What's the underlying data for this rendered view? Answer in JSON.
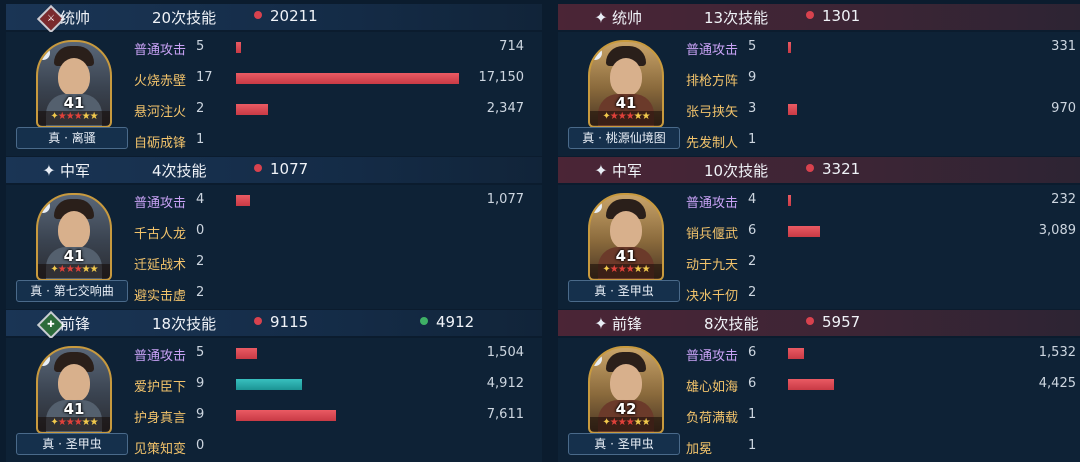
{
  "left": [
    {
      "role": "统帅",
      "skills": "20次技能",
      "damage": "20211",
      "heal": "",
      "emblem": "diamond-red",
      "level": "41",
      "name": "真 · 离骚",
      "rows": [
        {
          "name": "普通攻击",
          "uses": "5",
          "value": "714",
          "bar": 0.02,
          "color": "red",
          "basic": true
        },
        {
          "name": "火烧赤壁",
          "uses": "17",
          "value": "17,150",
          "bar": 0.98,
          "color": "red",
          "basic": false
        },
        {
          "name": "悬河注火",
          "uses": "2",
          "value": "2,347",
          "bar": 0.14,
          "color": "red",
          "basic": false
        },
        {
          "name": "自砺成锋",
          "uses": "1",
          "value": "",
          "bar": 0,
          "color": "red",
          "basic": false
        }
      ]
    },
    {
      "role": "中军",
      "skills": "4次技能",
      "damage": "1077",
      "heal": "",
      "emblem": "star",
      "level": "41",
      "name": "真 · 第七交响曲",
      "rows": [
        {
          "name": "普通攻击",
          "uses": "4",
          "value": "1,077",
          "bar": 0.06,
          "color": "red",
          "basic": true
        },
        {
          "name": "千古人龙",
          "uses": "0",
          "value": "",
          "bar": 0,
          "color": "red",
          "basic": false
        },
        {
          "name": "迁延战术",
          "uses": "2",
          "value": "",
          "bar": 0,
          "color": "red",
          "basic": false
        },
        {
          "name": "避实击虚",
          "uses": "2",
          "value": "",
          "bar": 0,
          "color": "red",
          "basic": false
        }
      ]
    },
    {
      "role": "前锋",
      "skills": "18次技能",
      "damage": "9115",
      "heal": "4912",
      "emblem": "diamond-green",
      "level": "41",
      "name": "真 · 圣甲虫",
      "rows": [
        {
          "name": "普通攻击",
          "uses": "5",
          "value": "1,504",
          "bar": 0.09,
          "color": "red",
          "basic": true
        },
        {
          "name": "爱护臣下",
          "uses": "9",
          "value": "4,912",
          "bar": 0.29,
          "color": "teal",
          "basic": false
        },
        {
          "name": "护身真言",
          "uses": "9",
          "value": "7,611",
          "bar": 0.44,
          "color": "red",
          "basic": false
        },
        {
          "name": "见策知变",
          "uses": "0",
          "value": "",
          "bar": 0,
          "color": "red",
          "basic": false
        }
      ]
    }
  ],
  "right": [
    {
      "role": "统帅",
      "skills": "13次技能",
      "damage": "1301",
      "heal": "",
      "emblem": "star",
      "level": "41",
      "name": "真 · 桃源仙境图",
      "rows": [
        {
          "name": "普通攻击",
          "uses": "5",
          "value": "331",
          "bar": 0.01,
          "color": "red",
          "basic": true
        },
        {
          "name": "排枪方阵",
          "uses": "9",
          "value": "",
          "bar": 0,
          "color": "red",
          "basic": false
        },
        {
          "name": "张弓挟矢",
          "uses": "3",
          "value": "970",
          "bar": 0.04,
          "color": "red",
          "basic": false
        },
        {
          "name": "先发制人",
          "uses": "1",
          "value": "",
          "bar": 0,
          "color": "red",
          "basic": false
        }
      ]
    },
    {
      "role": "中军",
      "skills": "10次技能",
      "damage": "3321",
      "heal": "",
      "emblem": "star",
      "level": "41",
      "name": "真 · 圣甲虫",
      "rows": [
        {
          "name": "普通攻击",
          "uses": "4",
          "value": "232",
          "bar": 0.01,
          "color": "red",
          "basic": true
        },
        {
          "name": "销兵偃武",
          "uses": "6",
          "value": "3,089",
          "bar": 0.14,
          "color": "red",
          "basic": false
        },
        {
          "name": "动于九天",
          "uses": "2",
          "value": "",
          "bar": 0,
          "color": "red",
          "basic": false
        },
        {
          "name": "决水千仞",
          "uses": "2",
          "value": "",
          "bar": 0,
          "color": "red",
          "basic": false
        }
      ]
    },
    {
      "role": "前锋",
      "skills": "8次技能",
      "damage": "5957",
      "heal": "",
      "emblem": "star",
      "level": "42",
      "name": "真 · 圣甲虫",
      "rows": [
        {
          "name": "普通攻击",
          "uses": "6",
          "value": "1,532",
          "bar": 0.07,
          "color": "red",
          "basic": true
        },
        {
          "name": "雄心如海",
          "uses": "6",
          "value": "4,425",
          "bar": 0.2,
          "color": "red",
          "basic": false
        },
        {
          "name": "负荷满载",
          "uses": "1",
          "value": "",
          "bar": 0,
          "color": "red",
          "basic": false
        },
        {
          "name": "加冕",
          "uses": "1",
          "value": "",
          "bar": 0,
          "color": "red",
          "basic": false
        }
      ]
    }
  ]
}
